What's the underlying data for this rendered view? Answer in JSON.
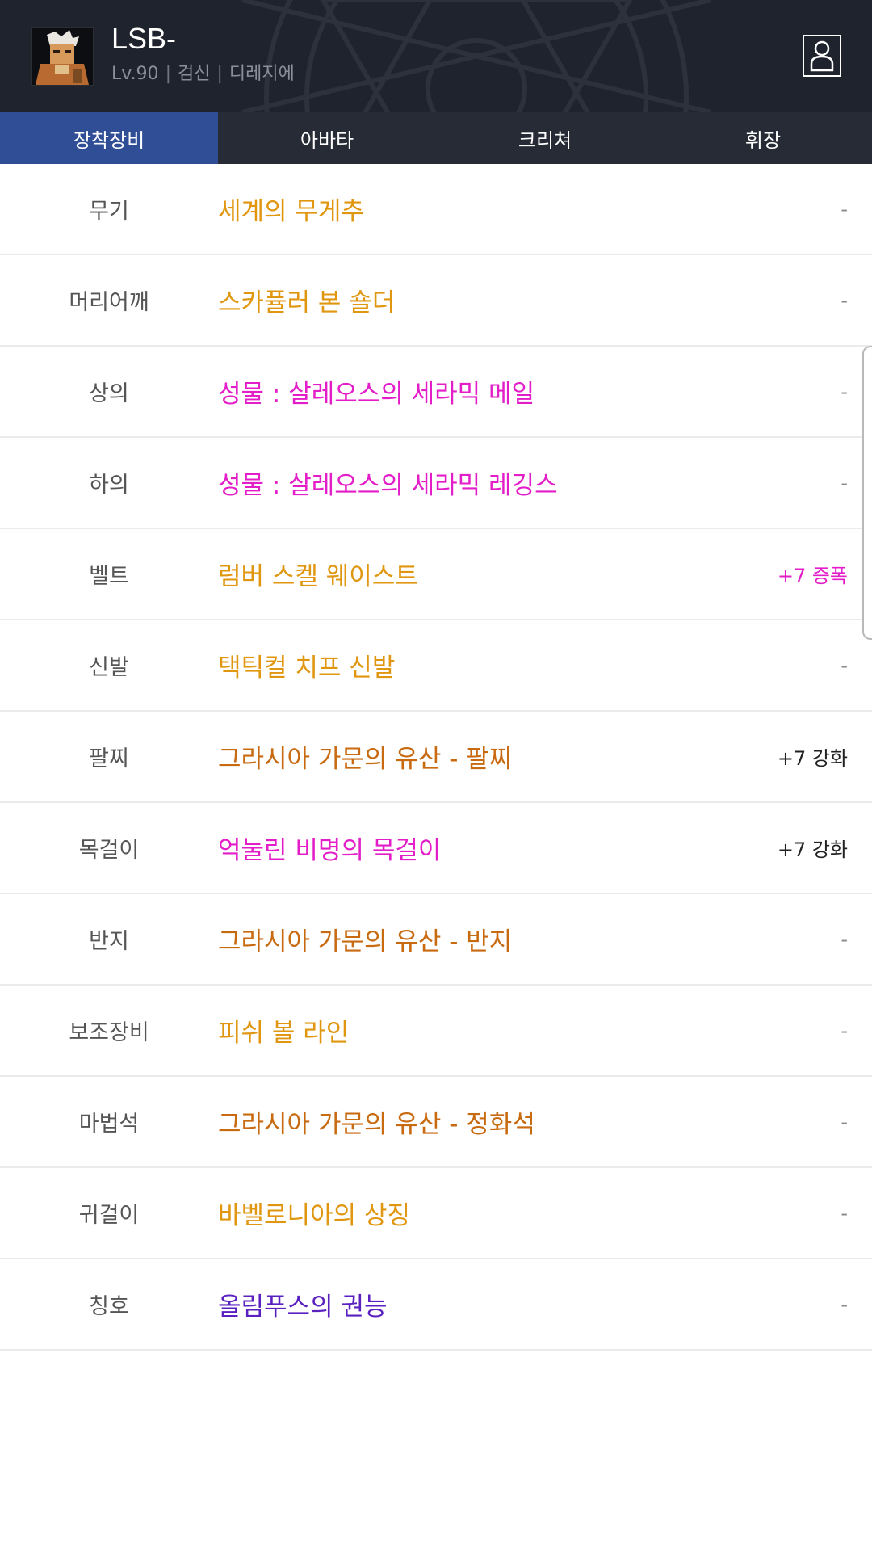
{
  "character": {
    "name": "LSB-",
    "level": "Lv.90",
    "job": "검신",
    "server": "디레지에",
    "separator": "|"
  },
  "icons": {
    "avatar": "character-portrait",
    "profile": "user-profile-icon"
  },
  "tabs": [
    {
      "label": "장착장비",
      "active": true
    },
    {
      "label": "아바타",
      "active": false
    },
    {
      "label": "크리쳐",
      "active": false
    },
    {
      "label": "휘장",
      "active": false
    }
  ],
  "equipment": [
    {
      "slot": "무기",
      "item": "세계의 무게추",
      "item_color": "#e0960f",
      "enchant": "-",
      "enchant_color": "#8a8a8a"
    },
    {
      "slot": "머리어깨",
      "item": "스카퓰러 본 숄더",
      "item_color": "#e0960f",
      "enchant": "-",
      "enchant_color": "#8a8a8a"
    },
    {
      "slot": "상의",
      "item": "성물 : 살레오스의 세라믹 메일",
      "item_color": "#e31ec9",
      "enchant": "-",
      "enchant_color": "#8a8a8a"
    },
    {
      "slot": "하의",
      "item": "성물 : 살레오스의 세라믹 레깅스",
      "item_color": "#e31ec9",
      "enchant": "-",
      "enchant_color": "#8a8a8a"
    },
    {
      "slot": "벨트",
      "item": "럼버 스켈 웨이스트",
      "item_color": "#e0960f",
      "enchant": "+7 증폭",
      "enchant_color": "#e31ec9"
    },
    {
      "slot": "신발",
      "item": "택틱컬 치프 신발",
      "item_color": "#e0960f",
      "enchant": "-",
      "enchant_color": "#8a8a8a"
    },
    {
      "slot": "팔찌",
      "item": "그라시아 가문의 유산 - 팔찌",
      "item_color": "#c86a10",
      "enchant": "+7 강화",
      "enchant_color": "#222222"
    },
    {
      "slot": "목걸이",
      "item": "억눌린 비명의 목걸이",
      "item_color": "#e31ec9",
      "enchant": "+7 강화",
      "enchant_color": "#222222"
    },
    {
      "slot": "반지",
      "item": "그라시아 가문의 유산 - 반지",
      "item_color": "#c86a10",
      "enchant": "-",
      "enchant_color": "#8a8a8a"
    },
    {
      "slot": "보조장비",
      "item": "피쉬 볼 라인",
      "item_color": "#e0960f",
      "enchant": "-",
      "enchant_color": "#8a8a8a"
    },
    {
      "slot": "마법석",
      "item": "그라시아 가문의 유산 - 정화석",
      "item_color": "#c86a10",
      "enchant": "-",
      "enchant_color": "#8a8a8a"
    },
    {
      "slot": "귀걸이",
      "item": "바벨로니아의 상징",
      "item_color": "#e0960f",
      "enchant": "-",
      "enchant_color": "#8a8a8a"
    },
    {
      "slot": "칭호",
      "item": "올림푸스의 권능",
      "item_color": "#5a20c0",
      "enchant": "-",
      "enchant_color": "#8a8a8a"
    }
  ]
}
